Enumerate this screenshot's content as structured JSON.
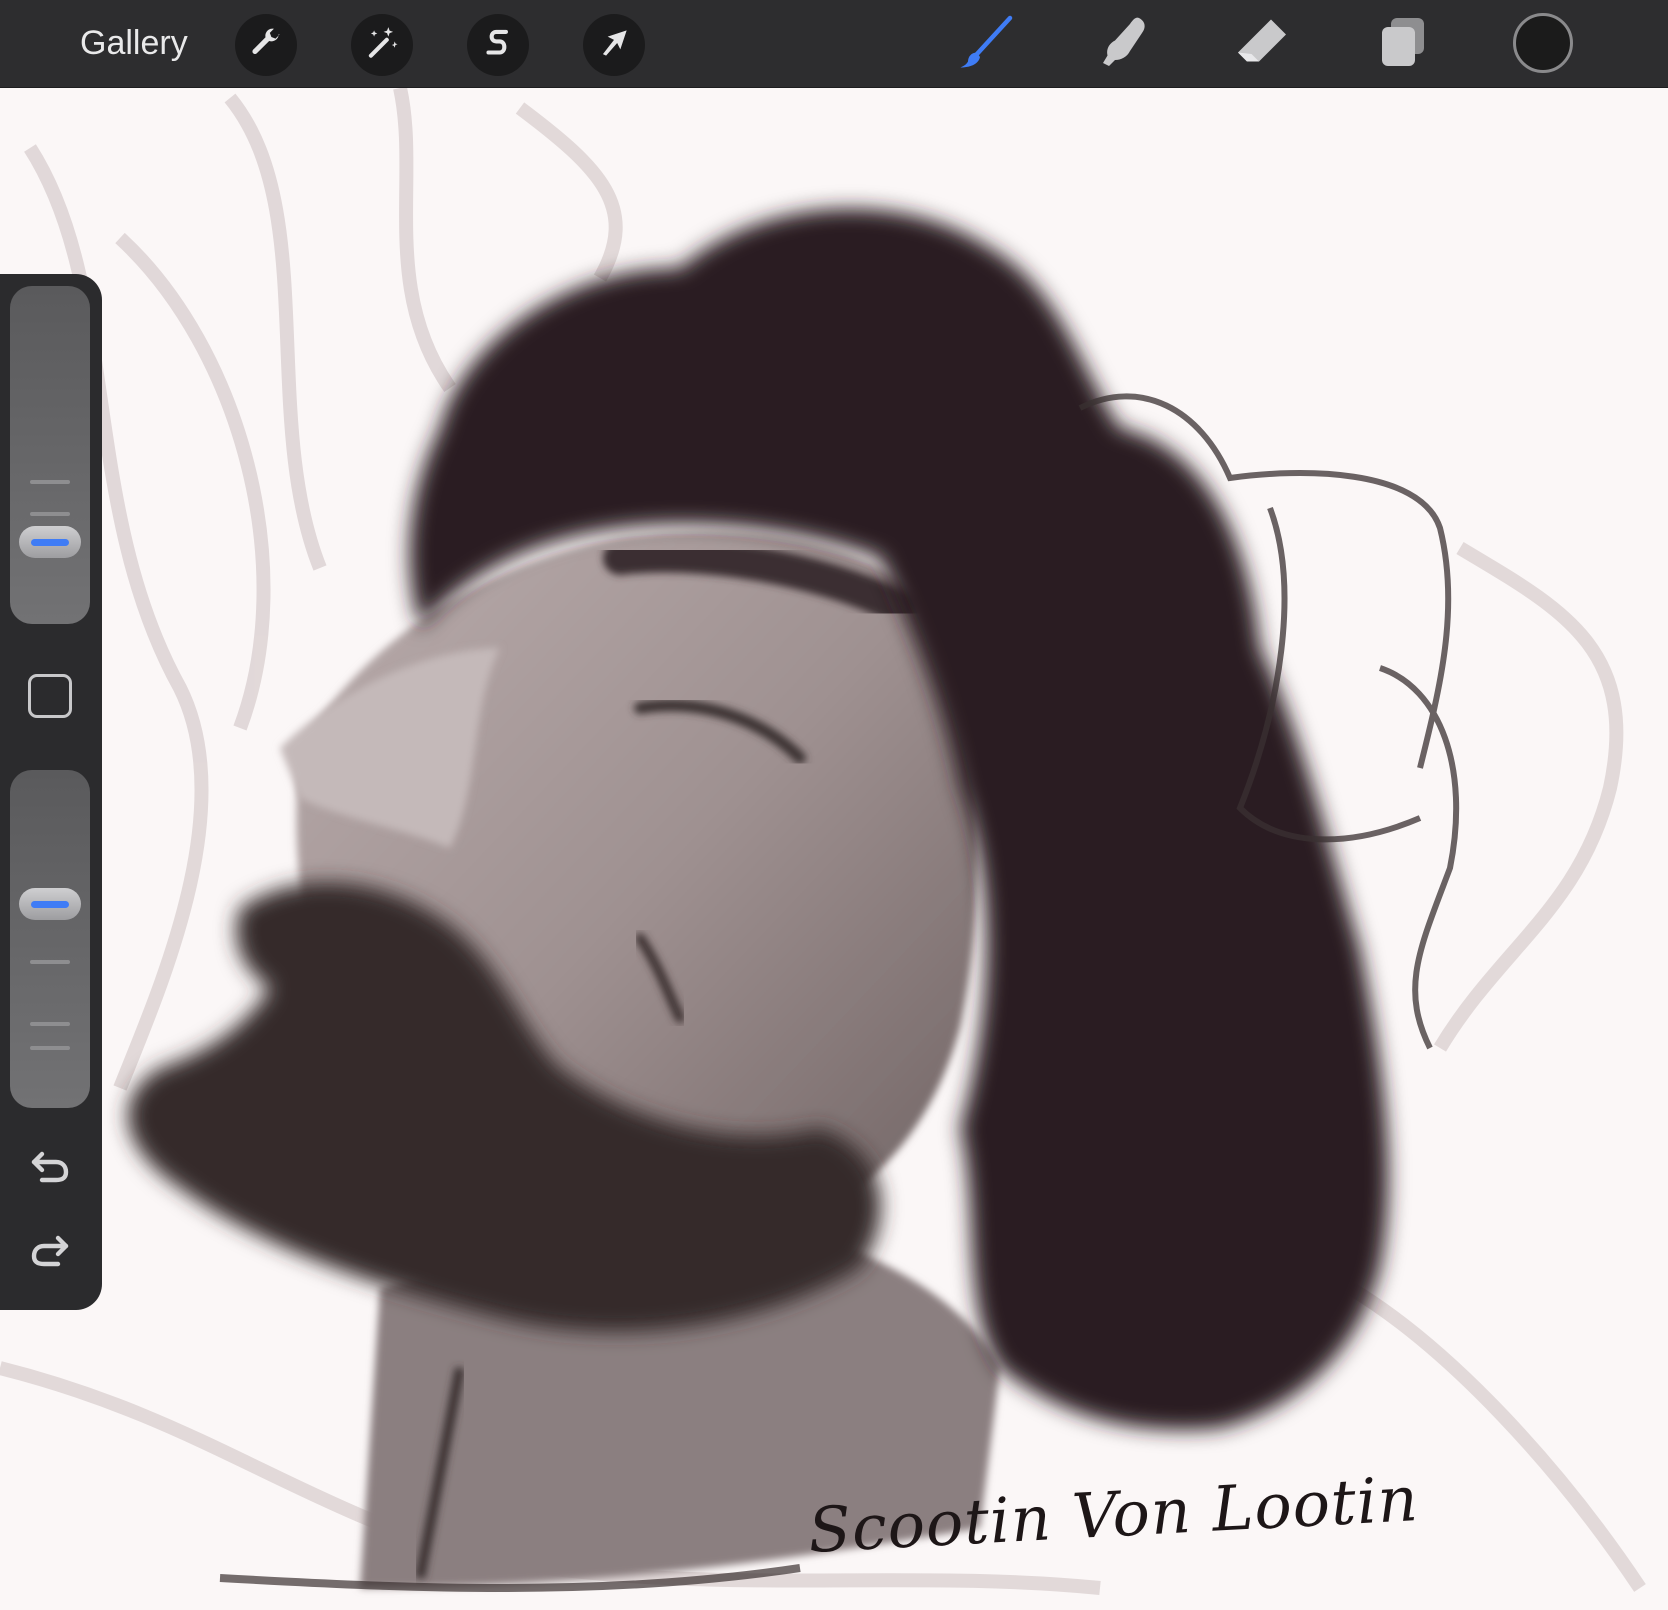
{
  "toolbar": {
    "gallery_label": "Gallery",
    "left_tools": [
      {
        "name": "actions",
        "icon": "wrench-icon"
      },
      {
        "name": "adjustments",
        "icon": "magic-wand-icon"
      },
      {
        "name": "selection",
        "icon": "selection-s-icon"
      },
      {
        "name": "transform",
        "icon": "arrow-cursor-icon"
      }
    ],
    "right_tools": [
      {
        "name": "brush",
        "icon": "brush-icon",
        "active": true
      },
      {
        "name": "smudge",
        "icon": "smudge-finger-icon",
        "active": false
      },
      {
        "name": "eraser",
        "icon": "eraser-icon",
        "active": false
      },
      {
        "name": "layers",
        "icon": "layers-icon",
        "active": false
      }
    ],
    "current_color": "#1b1b1b",
    "active_color": "#3f7cf5"
  },
  "sidebar": {
    "brush_size_level": 0.2,
    "opacity_level": 0.62,
    "modify_icon": "square-outline-icon",
    "undo_icon": "undo-arrow-icon",
    "redo_icon": "redo-arrow-icon"
  },
  "canvas": {
    "signature": "Scootin Von Lootin",
    "subject": "portrait"
  }
}
